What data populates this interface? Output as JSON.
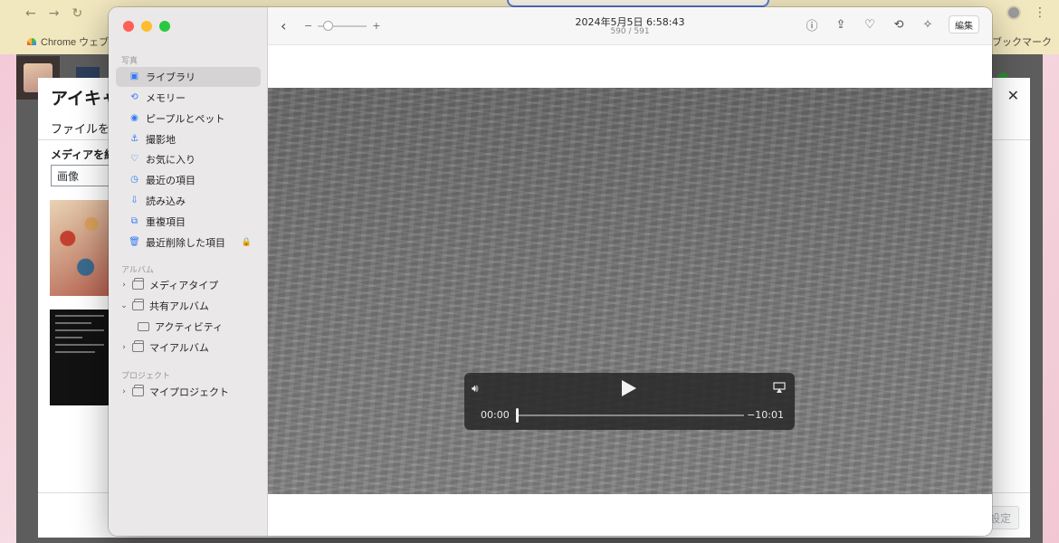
{
  "browser": {
    "bookmark_left": "Chrome ウェブス",
    "bookmark_right": "ブックマーク"
  },
  "wp_modal": {
    "title": "アイキャ",
    "tab_upload": "ファイルをア",
    "filter_label": "メディアを絞",
    "filter_value": "画像",
    "set_button": "設定"
  },
  "photos": {
    "sidebar": {
      "section_photos": "写真",
      "items": [
        {
          "label": "ライブラリ",
          "icon": "library-icon",
          "selected": true
        },
        {
          "label": "メモリー",
          "icon": "memories-icon"
        },
        {
          "label": "ピープルとペット",
          "icon": "people-icon"
        },
        {
          "label": "撮影地",
          "icon": "places-icon"
        },
        {
          "label": "お気に入り",
          "icon": "heart-icon"
        },
        {
          "label": "最近の項目",
          "icon": "clock-icon"
        },
        {
          "label": "読み込み",
          "icon": "import-icon"
        },
        {
          "label": "重複項目",
          "icon": "duplicates-icon"
        },
        {
          "label": "最近削除した項目",
          "icon": "trash-icon",
          "locked": true
        }
      ],
      "section_albums": "アルバム",
      "albums": [
        {
          "label": "メディアタイプ",
          "expanded": false
        },
        {
          "label": "共有アルバム",
          "expanded": true
        },
        {
          "label": "アクティビティ",
          "child": true
        },
        {
          "label": "マイアルバム",
          "expanded": false
        }
      ],
      "section_projects": "プロジェクト",
      "projects": [
        {
          "label": "マイプロジェクト",
          "expanded": false
        }
      ]
    },
    "toolbar": {
      "title": "2024年5月5日 6:58:43",
      "subtitle": "590 / 591",
      "zoom_minus": "−",
      "zoom_plus": "+",
      "zoom_level": 0.1,
      "edit_label": "編集"
    },
    "player": {
      "current_time": "00:00",
      "remaining_time": "−10:01",
      "progress": 0
    }
  }
}
